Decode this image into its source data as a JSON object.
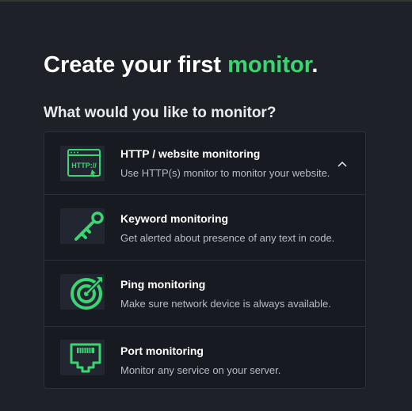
{
  "heading": {
    "prefix": "Create your first ",
    "accent": "monitor",
    "suffix": "."
  },
  "question": "What would you like to monitor?",
  "accent_color": "#3bd671",
  "options": [
    {
      "title": "HTTP / website monitoring",
      "description": "Use HTTP(s) monitor to monitor your website.",
      "icon": "http-browser-icon",
      "icon_text": "HTTP://",
      "expanded": true
    },
    {
      "title": "Keyword monitoring",
      "description": "Get alerted about presence of any text in code.",
      "icon": "key-icon"
    },
    {
      "title": "Ping monitoring",
      "description": "Make sure network device is always available.",
      "icon": "target-icon"
    },
    {
      "title": "Port monitoring",
      "description": "Monitor any service on your server.",
      "icon": "ethernet-port-icon"
    }
  ]
}
